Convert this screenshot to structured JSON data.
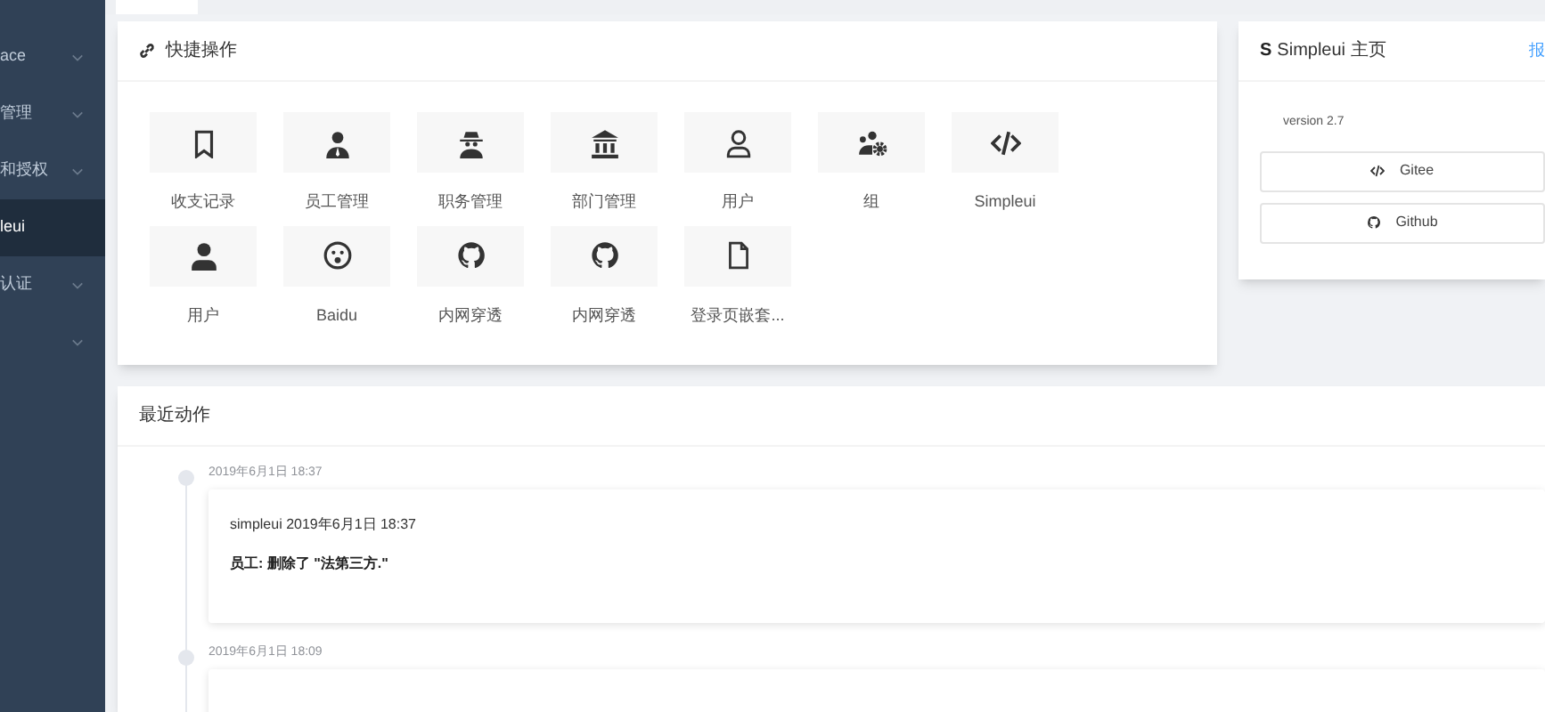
{
  "sidebar": {
    "items": [
      {
        "label": "ace",
        "selected": false,
        "expandable": true
      },
      {
        "label": "管理",
        "selected": false,
        "expandable": true
      },
      {
        "label": "和授权",
        "selected": false,
        "expandable": true
      },
      {
        "label": "leui",
        "selected": true,
        "expandable": false
      },
      {
        "label": "认证",
        "selected": false,
        "expandable": true
      },
      {
        "selected": false,
        "expandable": true
      }
    ]
  },
  "quick_actions": {
    "title": "快捷操作",
    "items": [
      {
        "label": "收支记录",
        "kind": "bookmark"
      },
      {
        "label": "员工管理",
        "kind": "employee"
      },
      {
        "label": "职务管理",
        "kind": "spy"
      },
      {
        "label": "部门管理",
        "kind": "bank"
      },
      {
        "label": "用户",
        "kind": "outline"
      },
      {
        "label": "组",
        "kind": "group"
      },
      {
        "label": "Simpleui",
        "kind": "code"
      },
      {
        "label": "用户",
        "kind": "person"
      },
      {
        "label": "Baidu",
        "kind": "face"
      },
      {
        "label": "内网穿透",
        "kind": "github"
      },
      {
        "label": "内网穿透",
        "kind": "github"
      },
      {
        "label": "登录页嵌套...",
        "kind": "file"
      }
    ]
  },
  "home": {
    "logo": "S",
    "title": "Simpleui 主页",
    "link": "报",
    "version": "version 2.7",
    "buttons": [
      {
        "label": "Gitee",
        "kind": "code"
      },
      {
        "label": "Github",
        "kind": "github"
      }
    ]
  },
  "recent": {
    "title": "最近动作",
    "entries": [
      {
        "time": "2019年6月1日 18:37",
        "header": "simpleui 2019年6月1日 18:37",
        "body": "员工: 删除了 \"法第三方.\""
      },
      {
        "time": "2019年6月1日 18:09"
      }
    ]
  }
}
